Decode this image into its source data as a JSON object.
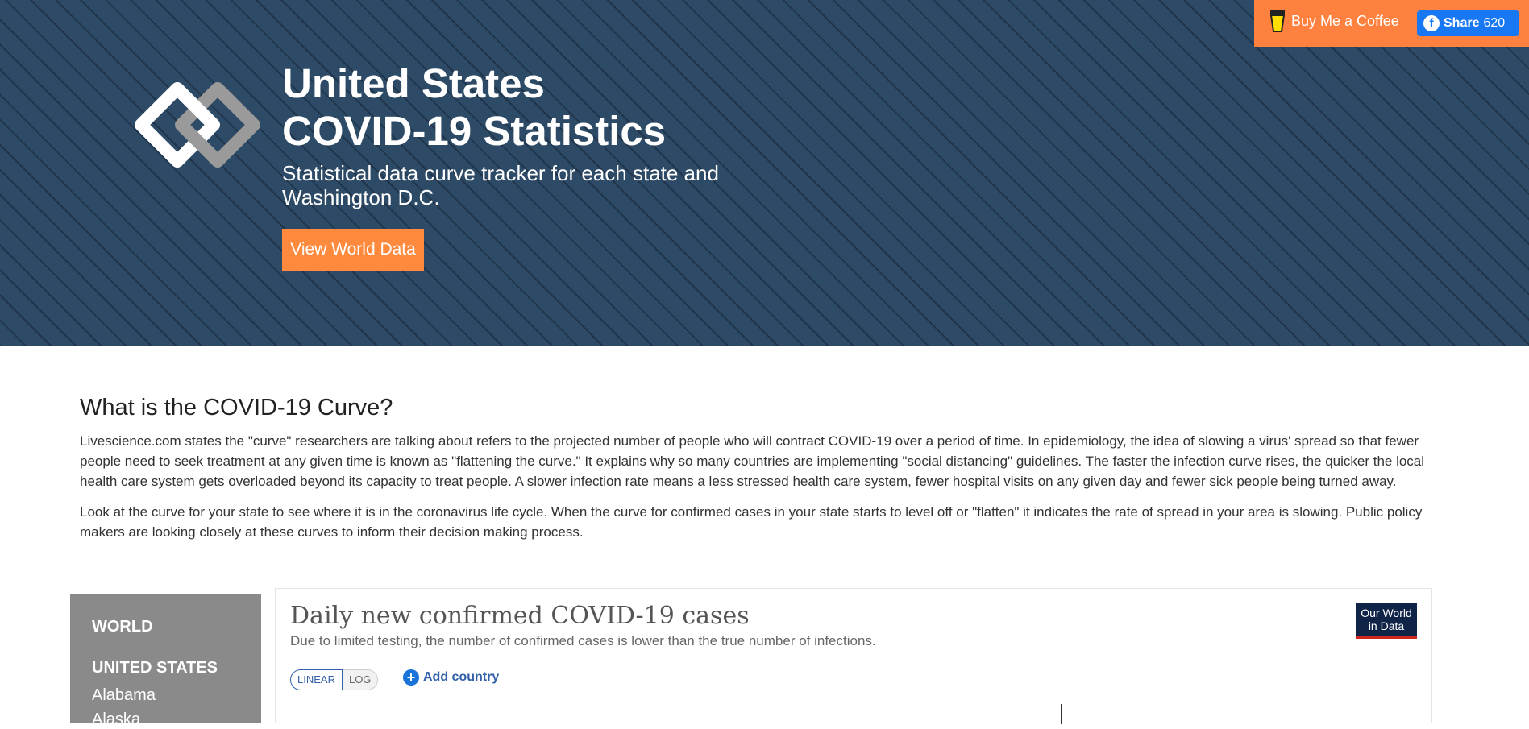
{
  "hero": {
    "title_line1": "United States",
    "title_line2": "COVID-19 Statistics",
    "subtitle": "Statistical data curve tracker for each state and Washington D.C.",
    "view_world_label": "View World Data"
  },
  "topbar": {
    "coffee_label": "Buy Me a Coffee",
    "share_label": "Share",
    "share_count": "620"
  },
  "article": {
    "heading": "What is the COVID-19 Curve?",
    "paragraph1": "Livescience.com states the \"curve\" researchers are talking about refers to the projected number of people who will contract COVID-19 over a period of time. In epidemiology, the idea of slowing a virus' spread so that fewer people need to seek treatment at any given time is known as \"flattening the curve.\" It explains why so many countries are implementing \"social distancing\" guidelines. The faster the infection curve rises, the quicker the local health care system gets overloaded beyond its capacity to treat people. A slower infection rate means a less stressed health care system, fewer hospital visits on any given day and fewer sick people being turned away.",
    "paragraph2": "Look at the curve for your state to see where it is in the coronavirus life cycle. When the curve for confirmed cases in your state starts to level off or \"flatten\" it indicates the rate of spread in your area is slowing. Public policy makers are looking closely at these curves to inform their decision making process."
  },
  "sidebar": {
    "world": "WORLD",
    "united_states": "UNITED STATES",
    "items": [
      "Alabama",
      "Alaska"
    ]
  },
  "chart": {
    "title": "Daily new confirmed COVID-19 cases",
    "subtitle": "Due to limited testing, the number of confirmed cases is lower than the true number of infections.",
    "logo_line1": "Our World",
    "logo_line2": "in Data",
    "linear_label": "LINEAR",
    "log_label": "LOG",
    "add_country_label": "Add country"
  },
  "colors": {
    "hero_bg": "#2d4a66",
    "accent_orange": "#ff8a3d",
    "facebook_blue": "#1877f2",
    "sidebar_gray": "#8a8a8a",
    "owid_navy": "#102447"
  }
}
